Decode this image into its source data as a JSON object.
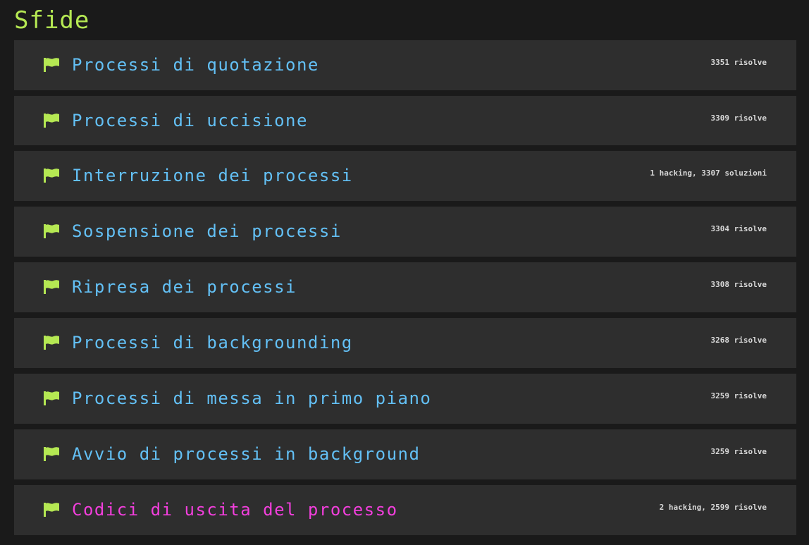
{
  "page": {
    "title": "Sfide"
  },
  "colors": {
    "background": "#1a1a1a",
    "card": "#2e2e2e",
    "title_green": "#b5e853",
    "link_blue": "#63c0f5",
    "highlight_magenta": "#f23fdc",
    "flag_green": "#b5e853"
  },
  "challenges": [
    {
      "title": "Processi di quotazione",
      "solves": "3351 risolve",
      "icon": "flag-icon"
    },
    {
      "title": "Processi di uccisione",
      "solves": "3309 risolve",
      "icon": "flag-icon"
    },
    {
      "title": "Interruzione dei processi",
      "solves": "1 hacking, 3307 soluzioni",
      "icon": "flag-icon"
    },
    {
      "title": "Sospensione dei processi",
      "solves": "3304 risolve",
      "icon": "flag-icon"
    },
    {
      "title": "Ripresa dei processi",
      "solves": "3308 risolve",
      "icon": "flag-icon"
    },
    {
      "title": "Processi di backgrounding",
      "solves": "3268 risolve",
      "icon": "flag-icon"
    },
    {
      "title": "Processi di messa in primo piano",
      "solves": "3259 risolve",
      "icon": "flag-icon"
    },
    {
      "title": "Avvio di processi in background",
      "solves": "3259 risolve",
      "icon": "flag-icon"
    },
    {
      "title": "Codici di uscita del processo",
      "solves": "2 hacking, 2599 risolve",
      "icon": "flag-icon",
      "highlighted": true
    }
  ]
}
